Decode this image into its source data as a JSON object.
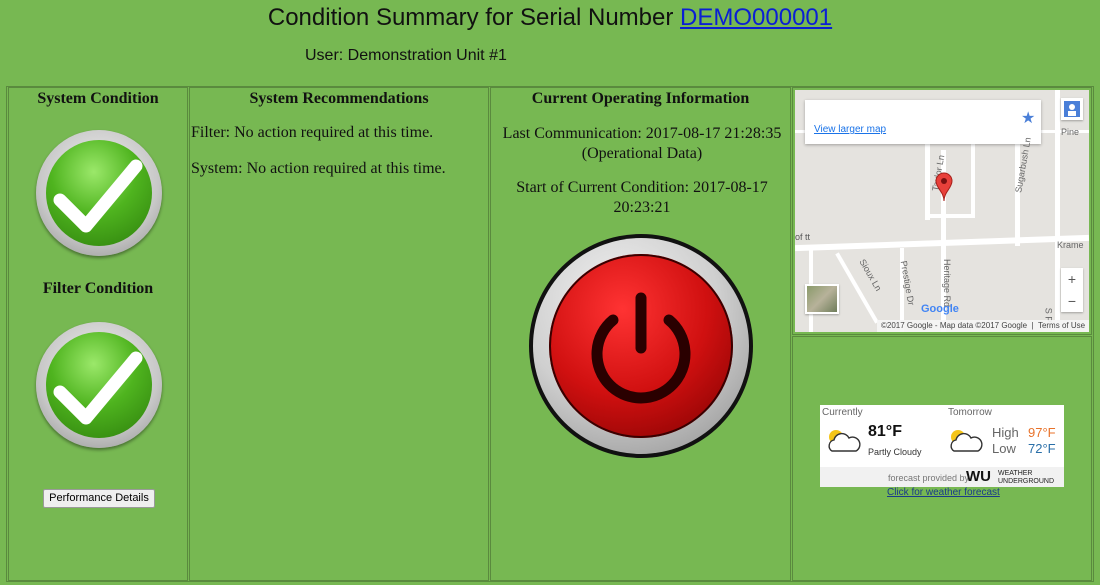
{
  "header": {
    "title_prefix": "Condition Summary for Serial Number",
    "serial_link": "DEMO000001",
    "user": "User: Demonstration Unit #1"
  },
  "system_condition": {
    "heading": "System Condition"
  },
  "filter_condition": {
    "heading": "Filter Condition"
  },
  "performance_button": "Performance Details",
  "recommendations": {
    "heading": "System Recommendations",
    "filter": "Filter: No action required at this time.",
    "system": "System: No action required at this time."
  },
  "operating": {
    "heading": "Current Operating Information",
    "last_comm": "Last Communication: 2017-08-17 21:28:35 (Operational Data)",
    "start": "Start of Current Condition: 2017-08-17 20:23:21"
  },
  "map": {
    "larger_link": "View larger map",
    "streets": [
      "Pine",
      "Taylor Ln",
      "Sugarbush Ln",
      "Krame",
      "Sioux Ln",
      "Prestige Dr",
      "Heritage Rd",
      "S P"
    ],
    "attribution": "©2017 Google - Map data ©2017 Google",
    "terms": "Terms of Use",
    "google": "Google",
    "place_fragment": "of tt"
  },
  "weather": {
    "currently_label": "Currently",
    "tomorrow_label": "Tomorrow",
    "current_temp": "81°F",
    "current_desc": "Partly Cloudy",
    "high_label": "High",
    "low_label": "Low",
    "high_temp": "97°F",
    "low_temp": "72°F",
    "provided_by": "forecast provided by",
    "provider_mark": "WU",
    "provider_name": "WEATHER UNDERGROUND",
    "forecast_link": "Click for weather forecast"
  }
}
